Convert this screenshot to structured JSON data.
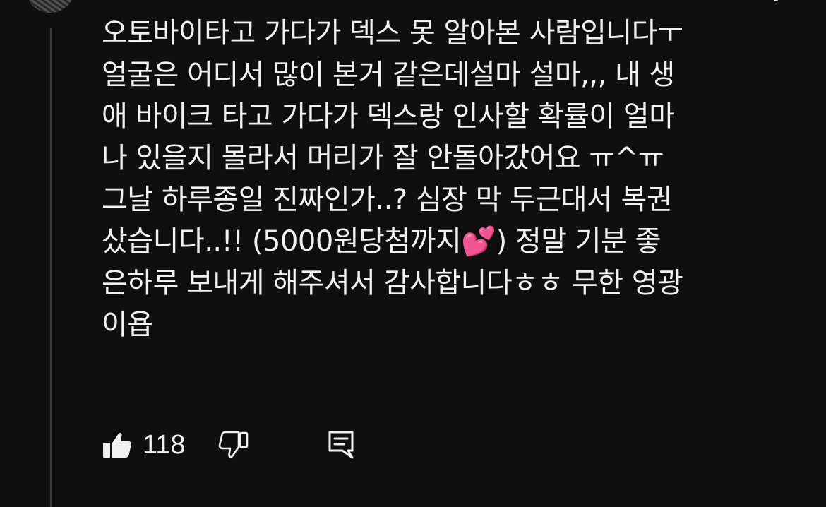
{
  "comment": {
    "lines": [
      "오토바이타고 가다가 덱스 못 알아본 사람입니다ㅜ",
      "얼굴은 어디서 많이 본거 같은데설마 설마,,, 내 생",
      "애 바이크 타고 가다가 덱스랑 인사할 확률이 얼마",
      "나 있을지 몰라서 머리가 잘 안돌아갔어요 ㅠ^ㅠ",
      "그날 하루종일 진짜인가..? 심장 막 두근대서 복권",
      "샀습니다..!! (5000원당첨까지💕) 정말 기분 좋",
      "은하루 보내게 해주셔서 감사합니다ㅎㅎ 무한 영광",
      "이욥"
    ]
  },
  "actions": {
    "like_count": "118"
  },
  "icons": {
    "like": "thumbs-up-icon",
    "dislike": "thumbs-down-icon",
    "reply": "reply-comment-icon",
    "more": "more-vertical-icon"
  },
  "colors": {
    "background": "#0f0f0f",
    "text": "#f1f1f1",
    "thread_line": "#3a3a3a"
  }
}
